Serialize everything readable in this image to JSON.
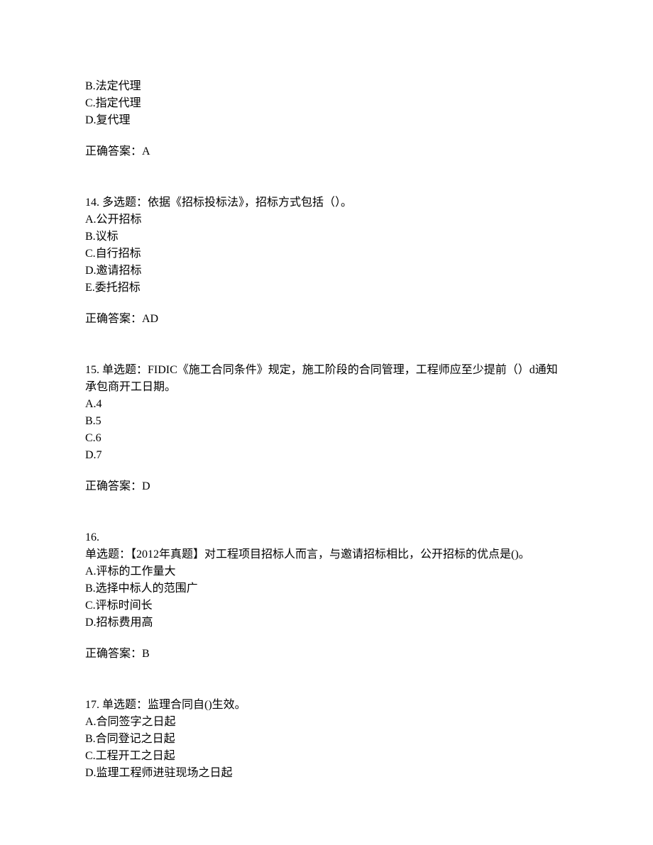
{
  "q13_partial": {
    "options": [
      "B.法定代理",
      "C.指定代理",
      "D.复代理"
    ],
    "answer": "正确答案：A"
  },
  "q14": {
    "question": "14. 多选题：依据《招标投标法》，招标方式包括（）。",
    "options": [
      "A.公开招标",
      "B.议标",
      "C.自行招标",
      "D.邀请招标",
      "E.委托招标"
    ],
    "answer": "正确答案：AD"
  },
  "q15": {
    "question": "15. 单选题：FIDIC《施工合同条件》规定，施工阶段的合同管理，工程师应至少提前（）d通知承包商开工日期。",
    "options": [
      "A.4",
      "B.5",
      "C.6",
      "D.7"
    ],
    "answer": "正确答案：D"
  },
  "q16": {
    "number": "16.",
    "question": "单选题：【2012年真题】对工程项目招标人而言，与邀请招标相比，公开招标的优点是()。",
    "options": [
      "A.评标的工作量大",
      "B.选择中标人的范围广",
      "C.评标时间长",
      "D.招标费用高"
    ],
    "answer": "正确答案：B"
  },
  "q17": {
    "question": "17. 单选题：监理合同自()生效。",
    "options": [
      "A.合同签字之日起",
      "B.合同登记之日起",
      "C.工程开工之日起",
      "D.监理工程师进驻现场之日起"
    ]
  }
}
